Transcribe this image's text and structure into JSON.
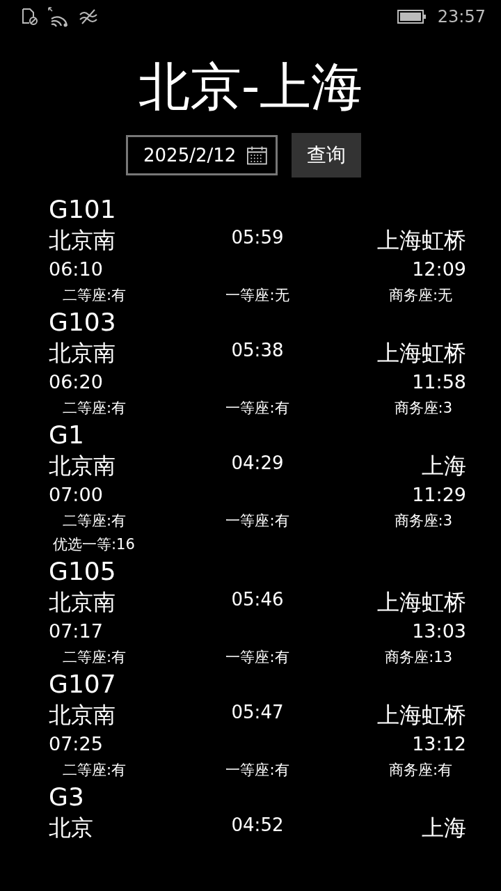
{
  "status_bar": {
    "time": "23:57"
  },
  "title": "北京-上海",
  "search": {
    "date": "2025/2/12",
    "button": "查询"
  },
  "trains": [
    {
      "number": "G101",
      "from": "北京南",
      "duration": "05:59",
      "to": "上海虹桥",
      "depart": "06:10",
      "arrive": "12:09",
      "seats": [
        "二等座:有",
        "一等座:无",
        "商务座:无"
      ]
    },
    {
      "number": "G103",
      "from": "北京南",
      "duration": "05:38",
      "to": "上海虹桥",
      "depart": "06:20",
      "arrive": "11:58",
      "seats": [
        "二等座:有",
        "一等座:有",
        "商务座:3"
      ]
    },
    {
      "number": "G1",
      "from": "北京南",
      "duration": "04:29",
      "to": "上海",
      "depart": "07:00",
      "arrive": "11:29",
      "seats": [
        "二等座:有",
        "一等座:有",
        "商务座:3",
        "优选一等:16"
      ]
    },
    {
      "number": "G105",
      "from": "北京南",
      "duration": "05:46",
      "to": "上海虹桥",
      "depart": "07:17",
      "arrive": "13:03",
      "seats": [
        "二等座:有",
        "一等座:有",
        "商务座:13"
      ]
    },
    {
      "number": "G107",
      "from": "北京南",
      "duration": "05:47",
      "to": "上海虹桥",
      "depart": "07:25",
      "arrive": "13:12",
      "seats": [
        "二等座:有",
        "一等座:有",
        "商务座:有"
      ]
    },
    {
      "number": "G3",
      "from": "北京",
      "duration": "04:52",
      "to": "上海"
    }
  ]
}
